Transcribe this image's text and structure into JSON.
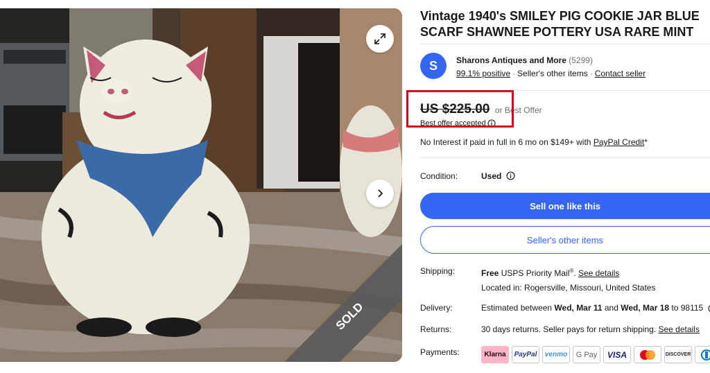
{
  "listing": {
    "title": "Vintage 1940's SMILEY PIG COOKIE JAR BLUE SCARF SHAWNEE POTTERY USA RARE MINT",
    "sold_label": "SOLD"
  },
  "seller": {
    "initial": "S",
    "name": "Sharons Antiques and More",
    "feedback_count": "(5299)",
    "positive": "99.1% positive",
    "other_items_link": "Seller's other items",
    "contact_link": "Contact seller"
  },
  "price": {
    "amount": "US $225.00",
    "suffix": "or Best Offer",
    "offer_status": "Best offer accepted"
  },
  "financing": {
    "text": "No Interest if paid in full in 6 mo on $149+ with ",
    "link": "PayPal Credit",
    "suffix": "*"
  },
  "condition": {
    "label": "Condition:",
    "value": "Used"
  },
  "buttons": {
    "sell_one": "Sell one like this",
    "sellers_other_items": "Seller's other items"
  },
  "shipping": {
    "label": "Shipping:",
    "free": "Free",
    "service": " USPS Priority Mail",
    "reg": "®",
    "link": "See details",
    "location": "Located in: Rogersville, Missouri, United States"
  },
  "delivery": {
    "label": "Delivery:",
    "prefix": "Estimated between ",
    "date1": "Wed, Mar 11",
    "and": " and ",
    "date2": "Wed, Mar 18",
    "zip": " to 98115"
  },
  "returns": {
    "label": "Returns:",
    "text": "30 days returns. Seller pays for return shipping. ",
    "link": "See details"
  },
  "payments": {
    "label": "Payments:",
    "methods": [
      "Klarna",
      "PayPal",
      "venmo",
      "G Pay",
      "VISA",
      "mastercard",
      "DISCOVER",
      "diners"
    ]
  },
  "colors": {
    "accent": "#3665f3",
    "highlight": "#e0001b",
    "sold_banner": "#5a5a5a"
  }
}
